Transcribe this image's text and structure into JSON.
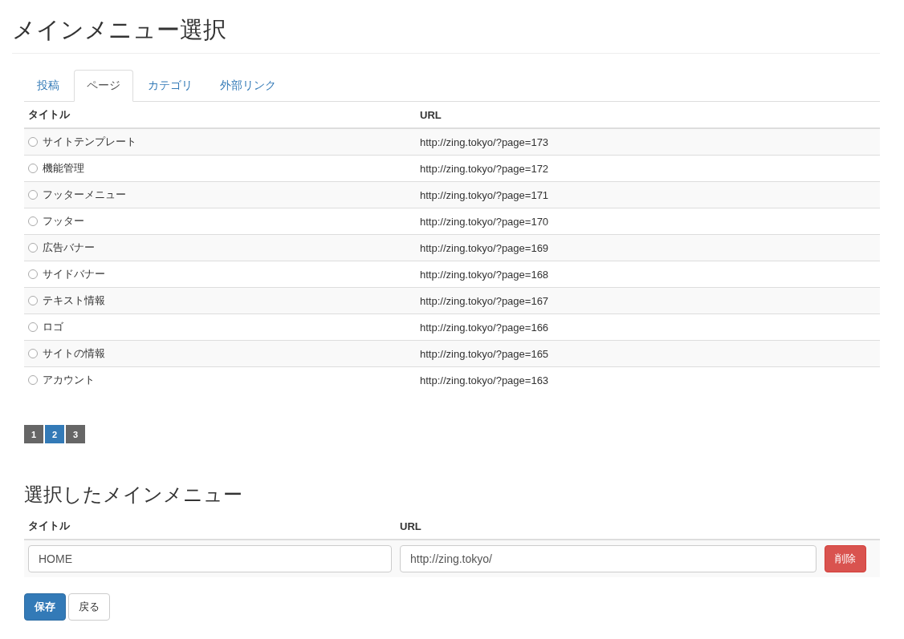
{
  "title": "メインメニュー選択",
  "tabs": [
    {
      "label": "投稿",
      "selected": false
    },
    {
      "label": "ページ",
      "selected": true
    },
    {
      "label": "カテゴリ",
      "selected": false
    },
    {
      "label": "外部リンク",
      "selected": false
    }
  ],
  "table": {
    "columns": [
      "タイトル",
      "URL"
    ],
    "rows": [
      {
        "title": "サイトテンプレート",
        "url": "http://zing.tokyo/?page=173",
        "selected": false
      },
      {
        "title": "機能管理",
        "url": "http://zing.tokyo/?page=172",
        "selected": false
      },
      {
        "title": "フッターメニュー",
        "url": "http://zing.tokyo/?page=171",
        "selected": false
      },
      {
        "title": "フッター",
        "url": "http://zing.tokyo/?page=170",
        "selected": false
      },
      {
        "title": "広告バナー",
        "url": "http://zing.tokyo/?page=169",
        "selected": false
      },
      {
        "title": "サイドバナー",
        "url": "http://zing.tokyo/?page=168",
        "selected": false
      },
      {
        "title": "テキスト情報",
        "url": "http://zing.tokyo/?page=167",
        "selected": false
      },
      {
        "title": "ロゴ",
        "url": "http://zing.tokyo/?page=166",
        "selected": false
      },
      {
        "title": "サイトの情報",
        "url": "http://zing.tokyo/?page=165",
        "selected": false
      },
      {
        "title": "アカウント",
        "url": "http://zing.tokyo/?page=163",
        "selected": false
      }
    ]
  },
  "pagination": [
    {
      "label": "1",
      "selected": false
    },
    {
      "label": "2",
      "selected": true
    },
    {
      "label": "3",
      "selected": false
    }
  ],
  "selected_section": {
    "heading": "選択したメインメニュー",
    "columns": [
      "タイトル",
      "URL"
    ],
    "rows": [
      {
        "title": "HOME",
        "url": "http://zing.tokyo/",
        "delete_button": "削除"
      }
    ]
  },
  "buttons": {
    "save": "保存",
    "back": "戻る"
  }
}
